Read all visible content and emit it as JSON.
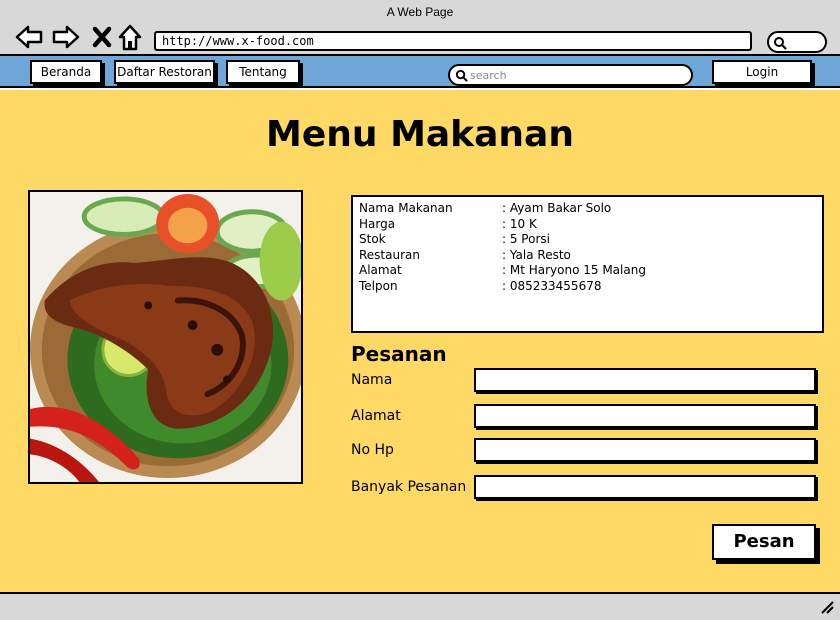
{
  "window": {
    "title": "A Web Page"
  },
  "browser": {
    "url": "http://www.x-food.com",
    "icons": [
      "back-arrow-icon",
      "forward-arrow-icon",
      "close-x-icon",
      "home-icon",
      "search-icon"
    ]
  },
  "navbar": {
    "items": [
      {
        "label": "Beranda"
      },
      {
        "label": "Daftar Restoran"
      },
      {
        "label": "Tentang"
      }
    ],
    "search_placeholder": "search",
    "login_label": "Login",
    "color": "#6ea6d8"
  },
  "page": {
    "title": "Menu Makanan",
    "background": "#ffd966"
  },
  "food_info": {
    "rows": [
      {
        "key": "Nama Makanan",
        "value": ": Ayam Bakar Solo"
      },
      {
        "key": "Harga",
        "value": ": 10 K"
      },
      {
        "key": "Stok",
        "value": ": 5 Porsi"
      },
      {
        "key": "Restauran",
        "value": ": Yala Resto"
      },
      {
        "key": "Alamat",
        "value": ": Mt Haryono 15 Malang"
      },
      {
        "key": "Telpon",
        "value": ": 085233455678"
      }
    ]
  },
  "order_form": {
    "title": "Pesanan",
    "fields": [
      {
        "label": "Nama",
        "value": ""
      },
      {
        "label": "Alamat",
        "value": ""
      },
      {
        "label": "No Hp",
        "value": ""
      },
      {
        "label": "Banyak Pesanan",
        "value": ""
      }
    ],
    "submit_label": "Pesan"
  }
}
